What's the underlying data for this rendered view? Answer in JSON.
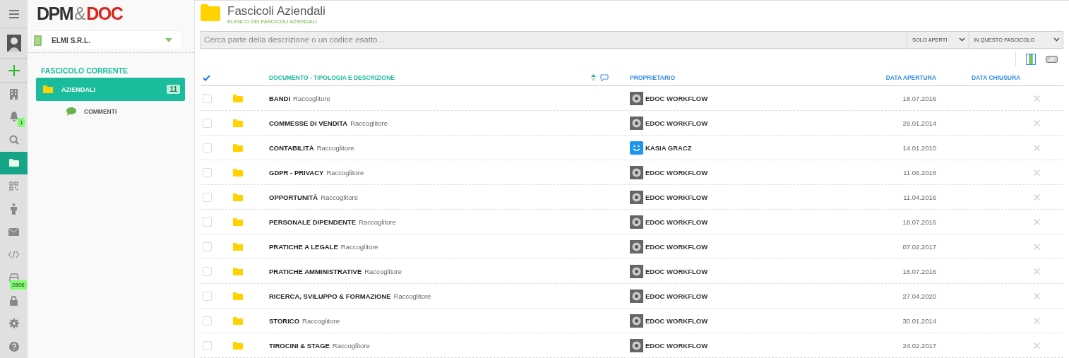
{
  "rail": [
    {
      "kind": "menu",
      "selected": false
    },
    {
      "kind": "avatar",
      "selected": false
    },
    {
      "kind": "add",
      "selected": false
    },
    {
      "kind": "building",
      "selected": false
    },
    {
      "kind": "bell",
      "selected": false,
      "badge": "1"
    },
    {
      "kind": "search",
      "selected": false
    },
    {
      "kind": "folder",
      "selected": true
    },
    {
      "kind": "qr",
      "selected": false
    },
    {
      "kind": "person",
      "selected": false
    },
    {
      "kind": "mail",
      "selected": false
    },
    {
      "kind": "code",
      "selected": false
    },
    {
      "kind": "inbox",
      "selected": false,
      "badge": "2806"
    },
    {
      "kind": "lock",
      "selected": false
    },
    {
      "kind": "settings",
      "selected": false
    },
    {
      "kind": "help",
      "selected": false
    }
  ],
  "logo": {
    "left": "DPM",
    "amp": "&",
    "right": "DOC"
  },
  "company": {
    "name": "ELMI S.R.L."
  },
  "tree": {
    "title": "FASCICOLO CORRENTE",
    "items": [
      {
        "label": "AZIENDALI",
        "count": "11",
        "selected": true,
        "children": [
          {
            "label": "COMMENTI",
            "selected": false
          }
        ]
      }
    ]
  },
  "header": {
    "title": "Fascicoli Aziendali",
    "subtitle": "ELENCO DEI FASCICOLI AZIENDALI"
  },
  "search": {
    "placeholder": "Cerca parte della descrizione o un codice esatto...",
    "filter": "SOLO APERTI",
    "scope": "IN QUESTO FASCICOLO"
  },
  "table": {
    "columns": [
      "DOCUMENTO - TIPOLOGIA E DESCRIZIONE",
      "PROPRIETARIO",
      "DATA APERTURA",
      "DATA CHIUSURA"
    ],
    "rows": [
      {
        "name": "BANDI",
        "type": "Raccoglitore",
        "owner": "EDOC WORKFLOW",
        "kind": "system",
        "opened": "18.07.2016",
        "checked": false
      },
      {
        "name": "COMMESSE DI VENDITA",
        "type": "Raccoglitore",
        "owner": "EDOC WORKFLOW",
        "kind": "system",
        "opened": "29.01.2014",
        "checked": false
      },
      {
        "name": "CONTABILITÀ",
        "type": "Raccoglitore",
        "owner": "KASIA GRACZ",
        "kind": "user",
        "opened": "14.01.2010",
        "checked": false
      },
      {
        "name": "GDPR - PRIVACY",
        "type": "Raccoglitore",
        "owner": "EDOC WORKFLOW",
        "kind": "system",
        "opened": "11.06.2018",
        "checked": false
      },
      {
        "name": "OPPORTUNITÀ",
        "type": "Raccoglitore",
        "owner": "EDOC WORKFLOW",
        "kind": "system",
        "opened": "11.04.2016",
        "checked": false
      },
      {
        "name": "PERSONALE DIPENDENTE",
        "type": "Raccoglitore",
        "owner": "EDOC WORKFLOW",
        "kind": "system",
        "opened": "18.07.2016",
        "checked": false
      },
      {
        "name": "PRATICHE A LEGALE",
        "type": "Raccoglitore",
        "owner": "EDOC WORKFLOW",
        "kind": "system",
        "opened": "07.02.2017",
        "checked": false
      },
      {
        "name": "PRATICHE AMMINISTRATIVE",
        "type": "Raccoglitore",
        "owner": "EDOC WORKFLOW",
        "kind": "system",
        "opened": "18.07.2016",
        "checked": false
      },
      {
        "name": "RICERCA, SVILUPPO & FORMAZIONE",
        "type": "Raccoglitore",
        "owner": "EDOC WORKFLOW",
        "kind": "system",
        "opened": "27.04.2020",
        "checked": false
      },
      {
        "name": "STORICO",
        "type": "Raccoglitore",
        "owner": "EDOC WORKFLOW",
        "kind": "system",
        "opened": "30.01.2014",
        "checked": false
      },
      {
        "name": "TIROCINI & STAGE",
        "type": "Raccoglitore",
        "owner": "EDOC WORKFLOW",
        "kind": "system",
        "opened": "24.02.2017",
        "checked": false
      }
    ]
  }
}
